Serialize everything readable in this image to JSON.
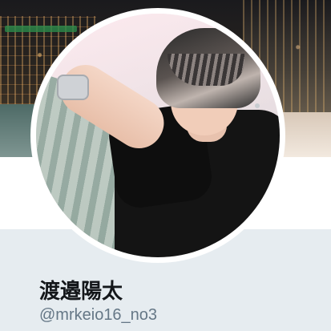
{
  "profile": {
    "display_name": "渡邉陽太",
    "handle": "@mrkeio16_no3"
  },
  "colors": {
    "page_bg": "#e6ecf0",
    "card_bg": "#ffffff",
    "name_text": "#14171a",
    "handle_text": "#657786"
  },
  "images": {
    "banner": "night-city-banner-image",
    "avatar": "profile-photo"
  }
}
